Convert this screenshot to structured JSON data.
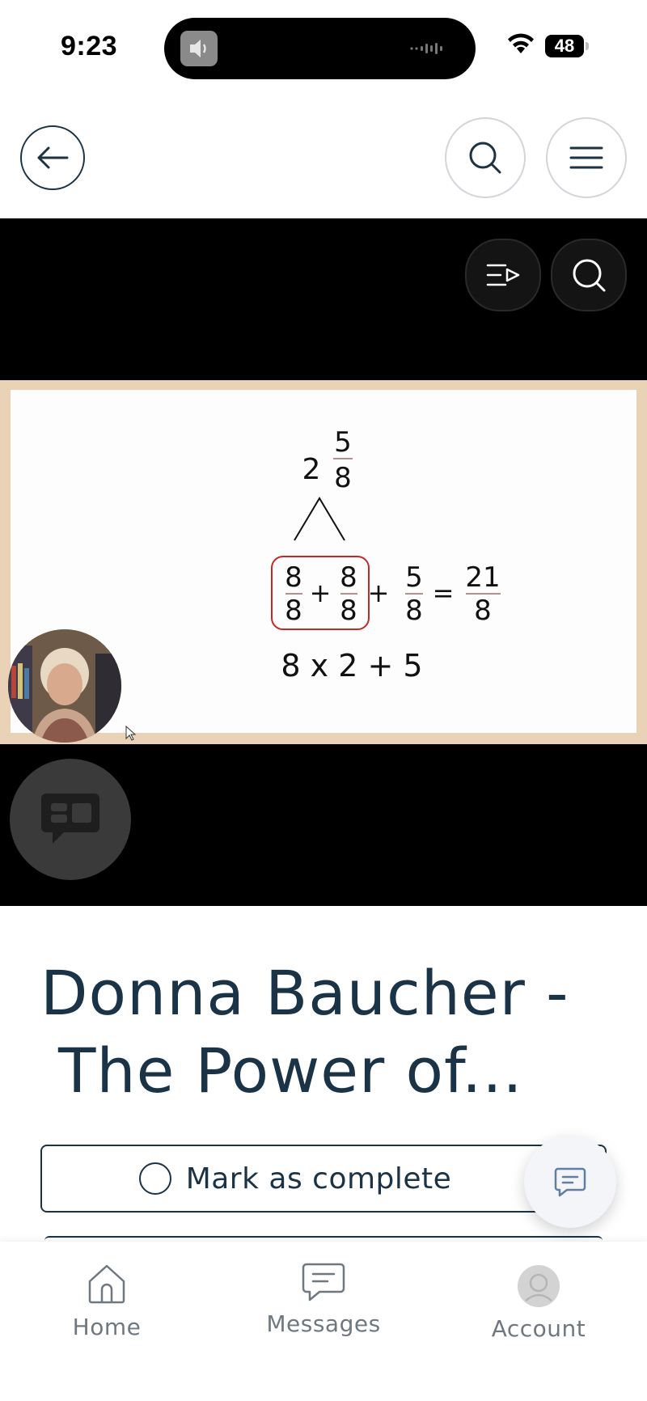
{
  "status_bar": {
    "time": "9:23",
    "battery": "48"
  },
  "header": {
    "back_icon": "arrow-left-icon",
    "search_icon": "search-icon",
    "menu_icon": "hamburger-menu-icon"
  },
  "video": {
    "controls": [
      {
        "icon": "playlist-icon"
      },
      {
        "icon": "search-icon"
      }
    ],
    "slide": {
      "mixed_number": {
        "whole": "2",
        "numerator": "5",
        "denominator": "8"
      },
      "equation": {
        "boxed_terms": [
          {
            "numerator": "8",
            "denominator": "8"
          },
          {
            "numerator": "8",
            "denominator": "8"
          }
        ],
        "plus": "+",
        "term3": {
          "numerator": "5",
          "denominator": "8"
        },
        "equals": "=",
        "result": {
          "numerator": "21",
          "denominator": "8"
        }
      },
      "expression": "8 x 2 + 5",
      "box_color": "#c62828"
    },
    "chat_overlay_icon": "chat-bubble-icon"
  },
  "lesson": {
    "title_line1": "Donna Baucher -",
    "title_line2": "The Power of..."
  },
  "mark_complete": {
    "label": "Mark as complete"
  },
  "fab": {
    "icon": "message-icon"
  },
  "bottom_nav": [
    {
      "label": "Home",
      "icon": "home-icon"
    },
    {
      "label": "Messages",
      "icon": "messages-icon"
    },
    {
      "label": "Account",
      "icon": "account-icon"
    }
  ],
  "colors": {
    "primary": "#1b3346",
    "muted": "#6f7880",
    "slide_border": "#e9d2b6"
  }
}
